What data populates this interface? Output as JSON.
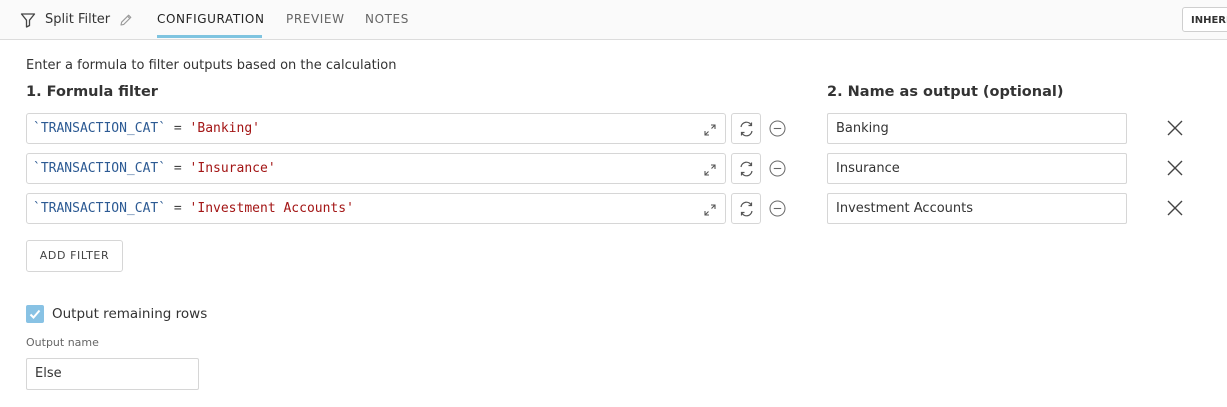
{
  "header": {
    "title": "Split Filter",
    "tabs": [
      {
        "label": "CONFIGURATION",
        "active": true
      },
      {
        "label": "PREVIEW",
        "active": false
      },
      {
        "label": "NOTES",
        "active": false
      }
    ],
    "inherit_label": "INHERI"
  },
  "main": {
    "description": "Enter a formula to filter outputs based on the calculation",
    "formula_heading": "1. Formula filter",
    "name_heading": "2. Name as output (optional)",
    "filters": [
      {
        "field": "`TRANSACTION_CAT`",
        "operator": " = ",
        "value": "'Banking'",
        "output_name": "Banking"
      },
      {
        "field": "`TRANSACTION_CAT`",
        "operator": " = ",
        "value": "'Insurance'",
        "output_name": "Insurance"
      },
      {
        "field": "`TRANSACTION_CAT`",
        "operator": " = ",
        "value": "'Investment Accounts'",
        "output_name": "Investment Accounts"
      }
    ],
    "add_filter_label": "ADD FILTER",
    "remaining": {
      "checked": true,
      "label": "Output remaining rows",
      "output_name_label": "Output name",
      "output_name_value": "Else"
    }
  },
  "icons": [
    "filter-icon",
    "pencil-icon",
    "expand-icon",
    "swap-icon",
    "minus-circle-icon",
    "close-icon",
    "check-icon"
  ],
  "colors": {
    "accent": "#7fc4e0",
    "checkbox": "#88c2e4",
    "field": "#2c5a93",
    "string": "#a31515"
  }
}
